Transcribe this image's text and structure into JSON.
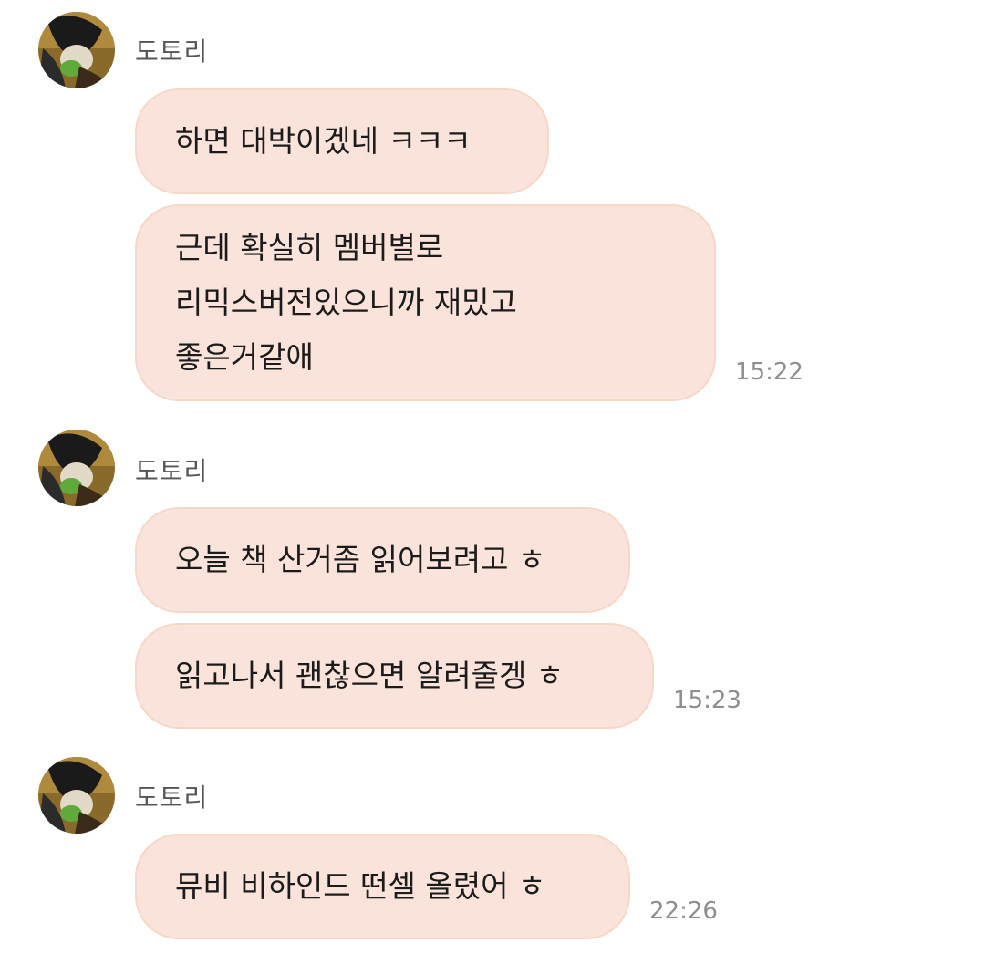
{
  "sender_name": "도토리",
  "colors": {
    "bubble_bg": "#fae3da",
    "bubble_border": "#f6d8c9",
    "time_text": "#8e8e8e",
    "sender_text": "#555555"
  },
  "groups": [
    {
      "sender": "도토리",
      "messages": [
        {
          "text": "하면 대박이겠네 ㅋㅋㅋ"
        },
        {
          "text": "근데 확실히 멤버별로\n리믹스버전있으니까 재밌고\n좋은거같애",
          "time": "15:22"
        }
      ]
    },
    {
      "sender": "도토리",
      "messages": [
        {
          "text": "오늘 책 산거좀 읽어보려고 ㅎ"
        },
        {
          "text": "읽고나서 괜찮으면 알려줄겡 ㅎ",
          "time": "15:23"
        }
      ]
    },
    {
      "sender": "도토리",
      "messages": [
        {
          "text": "뮤비 비하인드 떤셀 올렸어 ㅎ",
          "time": "22:26"
        }
      ]
    }
  ]
}
